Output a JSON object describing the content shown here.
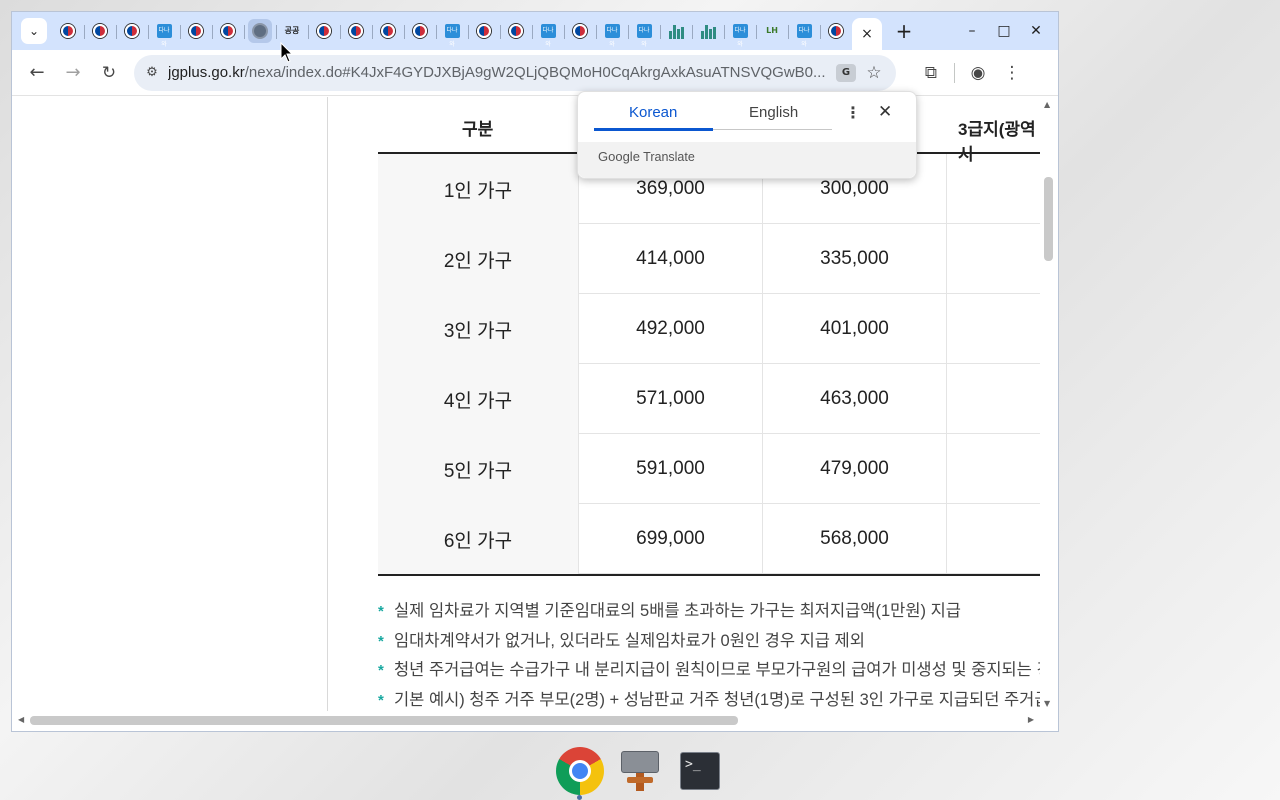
{
  "browser": {
    "tab_count": 25,
    "active_tab_close": "×",
    "new_tab_label": "+",
    "window_controls": {
      "minimize": "–",
      "maximize": "□",
      "close": "✕"
    }
  },
  "toolbar": {
    "url_host": "jgplus.go.kr",
    "url_path": "/nexa/index.do#K4JxF4GYDJXBjA9gW2QLjQBQMoH0CqAkrgAxkAsuATNSVQGwB0..."
  },
  "translate_popup": {
    "tab_source": "Korean",
    "tab_target": "English",
    "brand_google": "Google",
    "brand_translate": "Translate",
    "colors": {
      "active": "#0b57d0"
    }
  },
  "table": {
    "headers": [
      "구분",
      "3급지(광역시"
    ],
    "rows": [
      {
        "label": "1인 가구",
        "col1": "369,000",
        "col2": "300,000"
      },
      {
        "label": "2인 가구",
        "col1": "414,000",
        "col2": "335,000"
      },
      {
        "label": "3인 가구",
        "col1": "492,000",
        "col2": "401,000"
      },
      {
        "label": "4인 가구",
        "col1": "571,000",
        "col2": "463,000"
      },
      {
        "label": "5인 가구",
        "col1": "591,000",
        "col2": "479,000"
      },
      {
        "label": "6인 가구",
        "col1": "699,000",
        "col2": "568,000"
      }
    ]
  },
  "notes": [
    {
      "bullet": "*",
      "text": "실제 임차료가 지역별 기준임대료의 5배를 초과하는 가구는 최저지급액(1만원) 지급"
    },
    {
      "bullet": "*",
      "text": "임대차계약서가 없거나, 있더라도 실제임차료가 0원인 경우 지급 제외"
    },
    {
      "bullet": "*",
      "text": "청년 주거급여는 수급가구 내 분리지급이 원칙이므로 부모가구원의 급여가 미생성 및 중지되는 경"
    },
    {
      "bullet": "*",
      "text": "기본 예시) 청주 거주 부모(2명) + 성남판교 거주 청년(1명)로 구성된 3인 가구로 지급되던 주거급"
    }
  ],
  "favicon_sequence": [
    "kr",
    "kr",
    "kr",
    "blue",
    "kr",
    "kr",
    "globe",
    "text",
    "kr",
    "kr",
    "kr",
    "kr",
    "blue",
    "kr",
    "kr",
    "blue",
    "kr",
    "blue",
    "blue",
    "bars",
    "bars",
    "blue",
    "lh",
    "blue",
    "kr"
  ],
  "favicon_text": "공공",
  "favicon_blue_text": "다나와",
  "favicon_lh_text": "LH",
  "colors": {
    "tabstrip": "#d3e3fd",
    "bullet": "#17a8a0",
    "omnibox": "#e9eef6"
  }
}
